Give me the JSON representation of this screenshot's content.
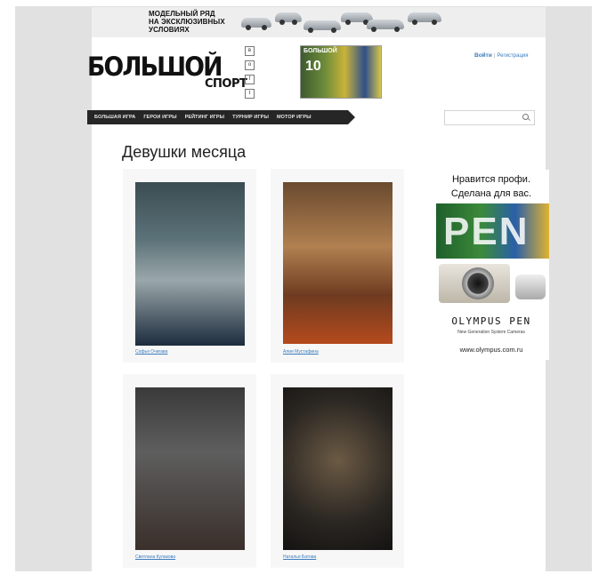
{
  "top_banner": {
    "title": "МОДЕЛЬНЫЙ РЯД НА ЭКСКЛЮЗИВНЫХ УСЛОВИЯХ"
  },
  "header": {
    "logo_word": "БОЛЬШОЙ",
    "logo_sport": "СПОРТ",
    "social_icons": [
      "vk-icon",
      "odnoklassniki-icon",
      "facebook-icon",
      "twitter-icon"
    ],
    "magazine_cover": {
      "title": "БОЛЬШОЙ",
      "number": "10"
    }
  },
  "auth": {
    "login_label": "Войти",
    "register_label": "Регистрация"
  },
  "nav": {
    "items": [
      "БОЛЬШАЯ ИГРА",
      "ГЕРОИ ИГРЫ",
      "РЕЙТИНГ ИГРЫ",
      "ТУРНИР ИГРЫ",
      "МОТОР ИГРЫ"
    ]
  },
  "search": {
    "placeholder": ""
  },
  "page": {
    "title": "Девушки месяца"
  },
  "gallery": [
    {
      "name": "Софья Очигава"
    },
    {
      "name": "Алия Мустафина"
    },
    {
      "name": "Светлана Кулакова"
    },
    {
      "name": "Наталья Батова"
    }
  ],
  "ad": {
    "headline": "Нравится профи. Сделана для вас.",
    "pen_text": "PEN",
    "brand": "OLYMPUS PEN",
    "subtitle": "New Generation System Cameras",
    "url": "www.olympus.com.ru"
  }
}
